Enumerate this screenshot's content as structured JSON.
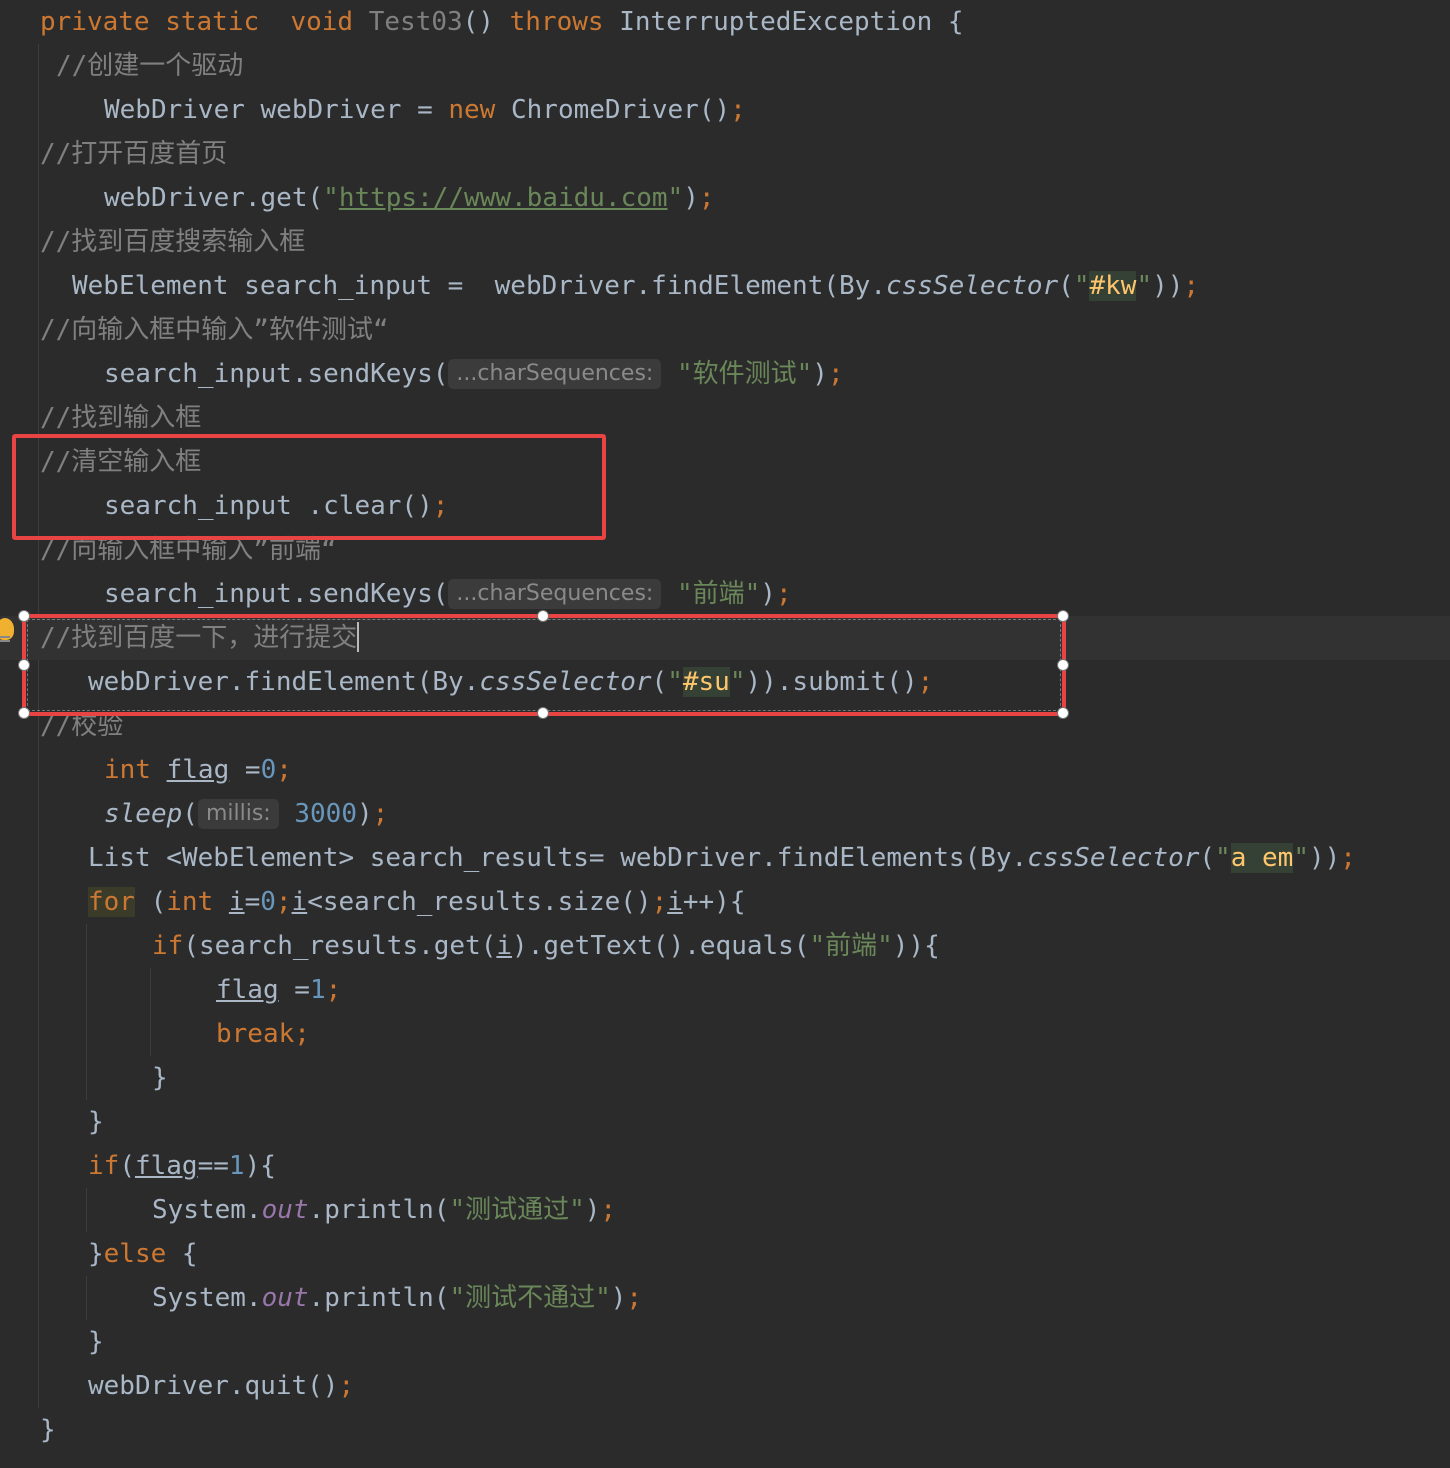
{
  "editor": {
    "theme_colors": {
      "background": "#2b2b2b",
      "keyword": "#cc7832",
      "string": "#6a8759",
      "comment": "#808080",
      "number": "#6897bb",
      "annotation_box": "#e94444"
    },
    "lines": {
      "l01": {
        "a": "private static  void ",
        "b": "Test03",
        "c": "() ",
        "d": "throws",
        "e": " InterruptedException {"
      },
      "l02": {
        "a": "//创建一个驱动"
      },
      "l03": {
        "a": "WebDriver webDriver = ",
        "b": "new",
        "c": " ChromeDriver()",
        "d": ";"
      },
      "l04": {
        "a": "//打开百度首页"
      },
      "l05": {
        "a": "webDriver.get(",
        "b": "\"",
        "c": "https://www.baidu.com",
        "d": "\"",
        "e": ")",
        "f": ";"
      },
      "l06": {
        "a": "//找到百度搜索输入框"
      },
      "l07": {
        "a": "WebElement search_input =  webDriver.findElement(By.",
        "b": "cssSelector",
        "c": "(",
        "d": "\"",
        "e": "#kw",
        "f": "\"",
        "g": "))",
        "h": ";"
      },
      "l08": {
        "a": "//向输入框中输入”软件测试“"
      },
      "l09": {
        "a": "search_input.sendKeys(",
        "hint": "...charSequences:",
        "b": "\"软件测试\"",
        "c": ")",
        "d": ";"
      },
      "l10": {
        "a": "//找到输入框"
      },
      "l11": {
        "a": "//清空输入框"
      },
      "l12": {
        "a": "search_input .clear()",
        "b": ";"
      },
      "l13": {
        "a": "//向输入框中输入”前端“"
      },
      "l14": {
        "a": "search_input.sendKeys(",
        "hint": "...charSequences:",
        "b": "\"前端\"",
        "c": ")",
        "d": ";"
      },
      "l15": {
        "a": "//找到百度一下，进行提交"
      },
      "l16": {
        "a": "webDriver.findElement(By.",
        "b": "cssSelector",
        "c": "(",
        "d": "\"",
        "e": "#su",
        "f": "\"",
        "g": ")).submit()",
        "h": ";"
      },
      "l17": {
        "a": "//校验"
      },
      "l18": {
        "a": "int",
        "b": " ",
        "c": "flag",
        "d": " =",
        "e": "0",
        "f": ";"
      },
      "l19": {
        "a": "sleep",
        "b": "(",
        "hint": "millis:",
        "c": "3000",
        "d": ")",
        "e": ";"
      },
      "l20": {
        "a": "List <WebElement> search_results= webDriver.findElements(By.",
        "b": "cssSelector",
        "c": "(",
        "d": "\"",
        "e": "a em",
        "f": "\"",
        "g": "))",
        "h": ";"
      },
      "l21": {
        "a": "for",
        "b": " (",
        "c": "int",
        "d": " ",
        "e": "i",
        "f": "=",
        "g": "0",
        "h": ";",
        "i": "i",
        "j": "<search_results.size()",
        "k": ";",
        "l": "i",
        "m": "++){"
      },
      "l22": {
        "a": "if",
        "b": "(search_results.get(",
        "c": "i",
        "d": ").getText().equals(",
        "e": "\"前端\"",
        "f": ")){"
      },
      "l23": {
        "a": "flag",
        "b": " =",
        "c": "1",
        "d": ";"
      },
      "l24": {
        "a": "break",
        "b": ";"
      },
      "l25": {
        "a": "}"
      },
      "l26": {
        "a": "}"
      },
      "l27": {
        "a": "if",
        "b": "(",
        "c": "flag",
        "d": "==",
        "e": "1",
        "f": "){"
      },
      "l28": {
        "a": "System.",
        "b": "out",
        "c": ".println(",
        "d": "\"测试通过\"",
        "e": ")",
        "f": ";"
      },
      "l29": {
        "a": "}",
        "b": "else",
        "c": " {"
      },
      "l30": {
        "a": "System.",
        "b": "out",
        "c": ".println(",
        "d": "\"测试不通过\"",
        "e": ")",
        "f": ";"
      },
      "l31": {
        "a": "}"
      },
      "l32": {
        "a": "webDriver.quit()",
        "b": ";"
      },
      "l33": {
        "a": "}"
      }
    }
  }
}
